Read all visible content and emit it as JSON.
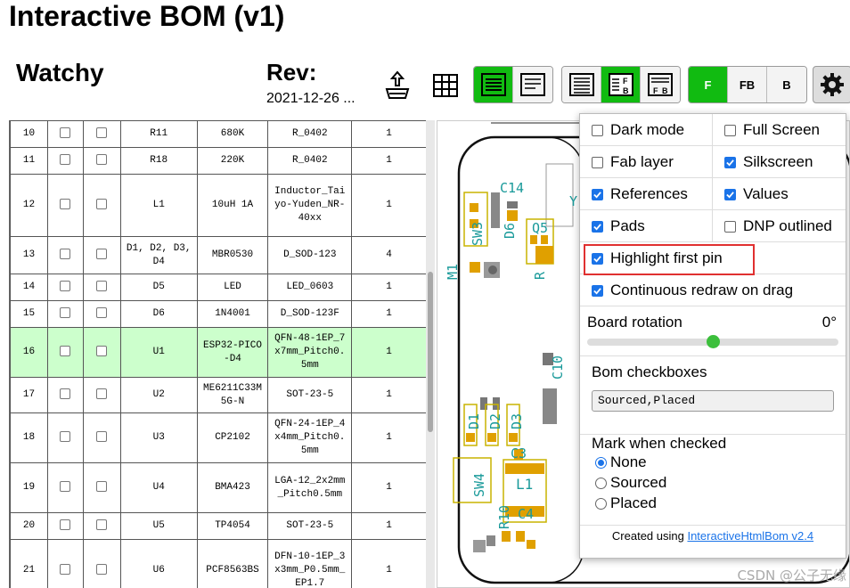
{
  "header": {
    "app_title": "Interactive BOM (v1)",
    "project": "Watchy",
    "rev_label": "Rev:",
    "rev_date": "2021-12-26 ..."
  },
  "toolbar": {
    "icons": [
      "export-icon",
      "grid-icon"
    ],
    "layout_group": [
      "bom-only",
      "bom-left-drawings-right"
    ],
    "bom_mode_group": [
      "ungrouped",
      "grouped-fb",
      "grouped-fb-netlist"
    ],
    "layer_group": [
      "F",
      "FB",
      "B"
    ],
    "active_layer": "F",
    "settings_icon": "gear-icon",
    "accent": "#11bb11"
  },
  "bom": {
    "rows": [
      {
        "num": "10",
        "refs": "R11",
        "value": "680K",
        "footprint": "R_0402",
        "qty": "1"
      },
      {
        "num": "11",
        "refs": "R18",
        "value": "220K",
        "footprint": "R_0402",
        "qty": "1"
      },
      {
        "num": "12",
        "refs": "L1",
        "value": "10uH 1A",
        "footprint": "Inductor_Taiyo-Yuden_NR-40xx",
        "qty": "1"
      },
      {
        "num": "13",
        "refs": "D1, D2, D3, D4",
        "value": "MBR0530",
        "footprint": "D_SOD-123",
        "qty": "4"
      },
      {
        "num": "14",
        "refs": "D5",
        "value": "LED",
        "footprint": "LED_0603",
        "qty": "1"
      },
      {
        "num": "15",
        "refs": "D6",
        "value": "1N4001",
        "footprint": "D_SOD-123F",
        "qty": "1"
      },
      {
        "num": "16",
        "refs": "U1",
        "value": "ESP32-PICO-D4",
        "footprint": "QFN-48-1EP_7x7mm_Pitch0.5mm",
        "qty": "1"
      },
      {
        "num": "17",
        "refs": "U2",
        "value": "ME6211C33M5G-N",
        "footprint": "SOT-23-5",
        "qty": "1"
      },
      {
        "num": "18",
        "refs": "U3",
        "value": "CP2102",
        "footprint": "QFN-24-1EP_4x4mm_Pitch0.5mm",
        "qty": "1"
      },
      {
        "num": "19",
        "refs": "U4",
        "value": "BMA423",
        "footprint": "LGA-12_2x2mm_Pitch0.5mm",
        "qty": "1"
      },
      {
        "num": "20",
        "refs": "U5",
        "value": "TP4054",
        "footprint": "SOT-23-5",
        "qty": "1"
      },
      {
        "num": "21",
        "refs": "U6",
        "value": "PCF8563BS",
        "footprint": "DFN-10-1EP_3x3mm_P0.5mm_EP1.7",
        "qty": "1"
      }
    ],
    "highlight_row": "16",
    "highlight_color": "#ccffcc"
  },
  "pcb_labels": {
    "c14": "C14",
    "sw3": "SW3",
    "d6": "D6",
    "q5": "Q5",
    "m1": "M1",
    "r_lbl": "R",
    "c10": "C10",
    "d1": "D1",
    "d2": "D2",
    "d3": "D3",
    "c3": "C3",
    "sw4": "SW4",
    "l1": "L1",
    "r10": "R10",
    "c4": "C4",
    "y": "Y"
  },
  "settings": {
    "dark_mode": {
      "label": "Dark mode",
      "checked": false
    },
    "full_screen": {
      "label": "Full Screen",
      "checked": false
    },
    "fab_layer": {
      "label": "Fab layer",
      "checked": false
    },
    "silkscreen": {
      "label": "Silkscreen",
      "checked": true
    },
    "references": {
      "label": "References",
      "checked": true
    },
    "values": {
      "label": "Values",
      "checked": true
    },
    "pads": {
      "label": "Pads",
      "checked": true
    },
    "dnp_outlined": {
      "label": "DNP outlined",
      "checked": false
    },
    "highlight_first_pin": {
      "label": "Highlight first pin",
      "checked": true
    },
    "continuous_redraw": {
      "label": "Continuous redraw on drag",
      "checked": true
    },
    "board_rotation_label": "Board rotation",
    "board_rotation_value": "0°",
    "board_rotation_fraction": 0.5,
    "bom_checkboxes_label": "Bom checkboxes",
    "bom_checkboxes_value": "Sourced,Placed",
    "mark_when_checked_label": "Mark when checked",
    "mark_options": [
      "None",
      "Sourced",
      "Placed"
    ],
    "mark_selected": "None",
    "created_using": "Created using ",
    "created_link": "InteractiveHtmlBom v2.4"
  },
  "watermark": "CSDN @公子无缘"
}
